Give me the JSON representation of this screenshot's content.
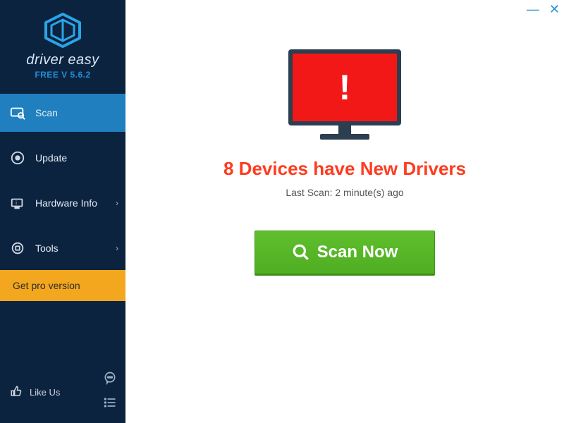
{
  "brand": {
    "name": "driver easy",
    "version_label": "FREE V 5.6.2"
  },
  "window": {
    "minimize_tip": "Minimize",
    "close_tip": "Close"
  },
  "sidebar": {
    "items": [
      {
        "label": "Scan",
        "icon": "scan-icon",
        "active": true,
        "chevron": false
      },
      {
        "label": "Update",
        "icon": "update-icon",
        "active": false,
        "chevron": false
      },
      {
        "label": "Hardware Info",
        "icon": "hwinfo-icon",
        "active": false,
        "chevron": true
      },
      {
        "label": "Tools",
        "icon": "tools-icon",
        "active": false,
        "chevron": true
      }
    ],
    "get_pro_label": "Get pro version",
    "like_us_label": "Like Us",
    "feedback_tip": "Feedback",
    "menu_tip": "Menu"
  },
  "main": {
    "alert_glyph": "!",
    "headline": "8 Devices have New Drivers",
    "last_scan_text": "Last Scan: 2 minute(s) ago",
    "scan_button_label": "Scan Now"
  },
  "scan_summary": {
    "devices_with_new_drivers": 8,
    "last_scan_minutes_ago": 2
  }
}
